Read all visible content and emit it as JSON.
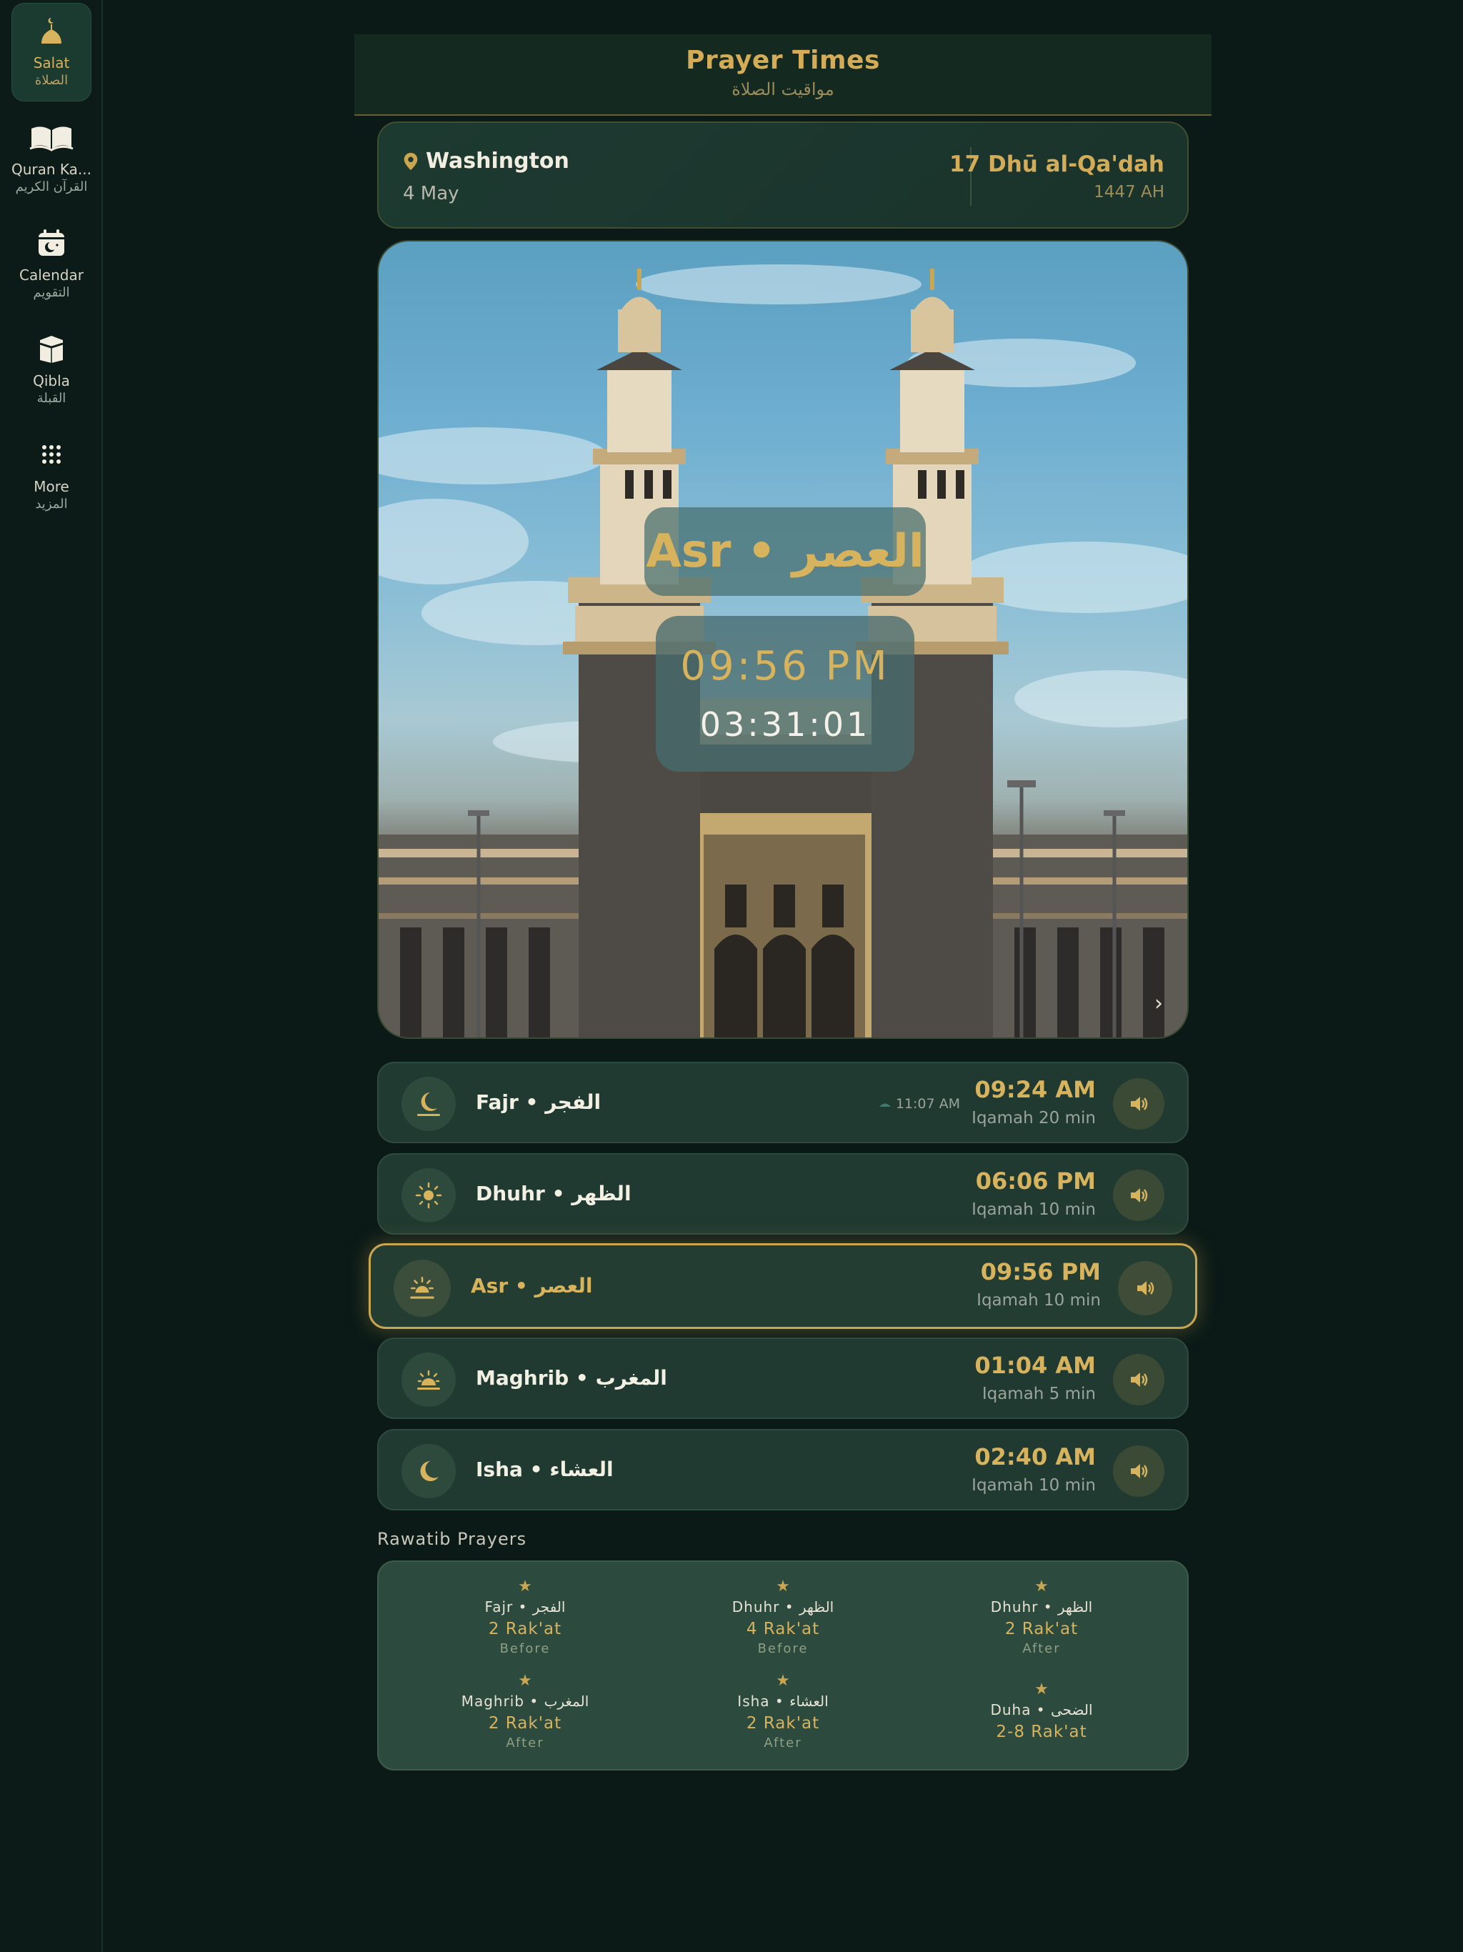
{
  "sidebar": {
    "items": [
      {
        "label": "Salat",
        "label_ar": "الصلاة",
        "icon": "mosque-icon",
        "active": true
      },
      {
        "label": "Quran Ka...",
        "label_ar": "القرآن الكريم",
        "icon": "open-book-icon",
        "active": false
      },
      {
        "label": "Calendar",
        "label_ar": "التقويم",
        "icon": "calendar-icon",
        "active": false
      },
      {
        "label": "Qibla",
        "label_ar": "القبلة",
        "icon": "kaaba-icon",
        "active": false
      },
      {
        "label": "More",
        "label_ar": "المزيد",
        "icon": "grid-icon",
        "active": false
      }
    ]
  },
  "header": {
    "title": "Prayer Times",
    "subtitle": "مواقيت الصلاة"
  },
  "location": {
    "city": "Washington",
    "date": "4 May",
    "hijri_date": "17 Dhū al-Qa'dah",
    "hijri_year": "1447 AH"
  },
  "hero": {
    "prayer": "Asr • العصر",
    "time": "09:56 PM",
    "countdown": "03:31:01",
    "next_glyph": "›"
  },
  "prayers": [
    {
      "name": "Fajr • الفجر",
      "time": "09:24 AM",
      "iqamah": "Iqamah 20 min",
      "sunrise": "11:07 AM",
      "icon": "moon-horizon-icon",
      "active": false
    },
    {
      "name": "Dhuhr • الظهر",
      "time": "06:06 PM",
      "iqamah": "Iqamah 10 min",
      "icon": "sun-icon",
      "active": false
    },
    {
      "name": "Asr • العصر",
      "time": "09:56 PM",
      "iqamah": "Iqamah 10 min",
      "icon": "sun-horizon-icon",
      "active": true
    },
    {
      "name": "Maghrib • المغرب",
      "time": "01:04 AM",
      "iqamah": "Iqamah 5 min",
      "icon": "sunset-icon",
      "active": false
    },
    {
      "name": "Isha • العشاء",
      "time": "02:40 AM",
      "iqamah": "Iqamah 10 min",
      "icon": "moon-icon",
      "active": false
    }
  ],
  "rawatib": {
    "title": "Rawatib Prayers",
    "items": [
      {
        "name": "Fajr • الفجر",
        "rakat": "2 Rak'at",
        "when": "Before"
      },
      {
        "name": "Dhuhr • الظهر",
        "rakat": "4 Rak'at",
        "when": "Before"
      },
      {
        "name": "Dhuhr • الظهر",
        "rakat": "2 Rak'at",
        "when": "After"
      },
      {
        "name": "Maghrib • المغرب",
        "rakat": "2 Rak'at",
        "when": "After"
      },
      {
        "name": "Isha • العشاء",
        "rakat": "2 Rak'at",
        "when": "After"
      },
      {
        "name": "Duha • الضحى",
        "rakat": "2-8 Rak'at",
        "when": ""
      }
    ]
  },
  "colors": {
    "background": "#0b1a17",
    "card": "#203a31",
    "accent_gold": "#d8b35d",
    "active_border": "#c9a64f"
  }
}
